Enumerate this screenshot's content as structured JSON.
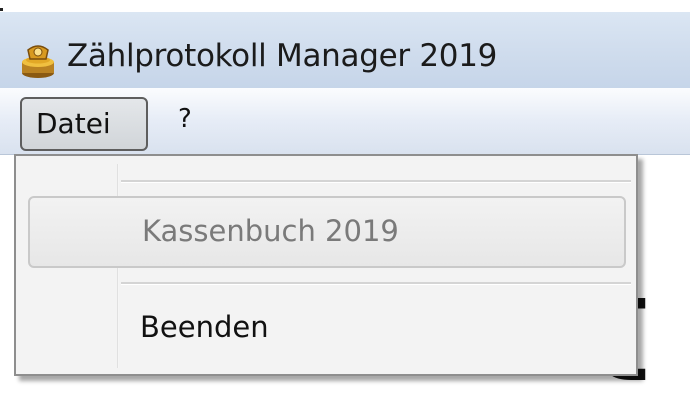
{
  "window": {
    "title": "Zählprotokoll Manager 2019",
    "icon": "coin-stack-icon"
  },
  "menubar": {
    "items": [
      {
        "label": "Datei",
        "active": true
      },
      {
        "label": "?",
        "active": false
      }
    ]
  },
  "dropdown": {
    "items": [
      {
        "label": "Kassenbuch 2019",
        "enabled": false,
        "highlighted": true
      },
      {
        "label": "Beenden",
        "enabled": true,
        "highlighted": false
      }
    ]
  },
  "background": {
    "partial_text": "t"
  },
  "colors": {
    "titlebar": "#cfdced",
    "disabled_text": "#7a7a7a",
    "menu_bg": "#f3f3f3"
  }
}
